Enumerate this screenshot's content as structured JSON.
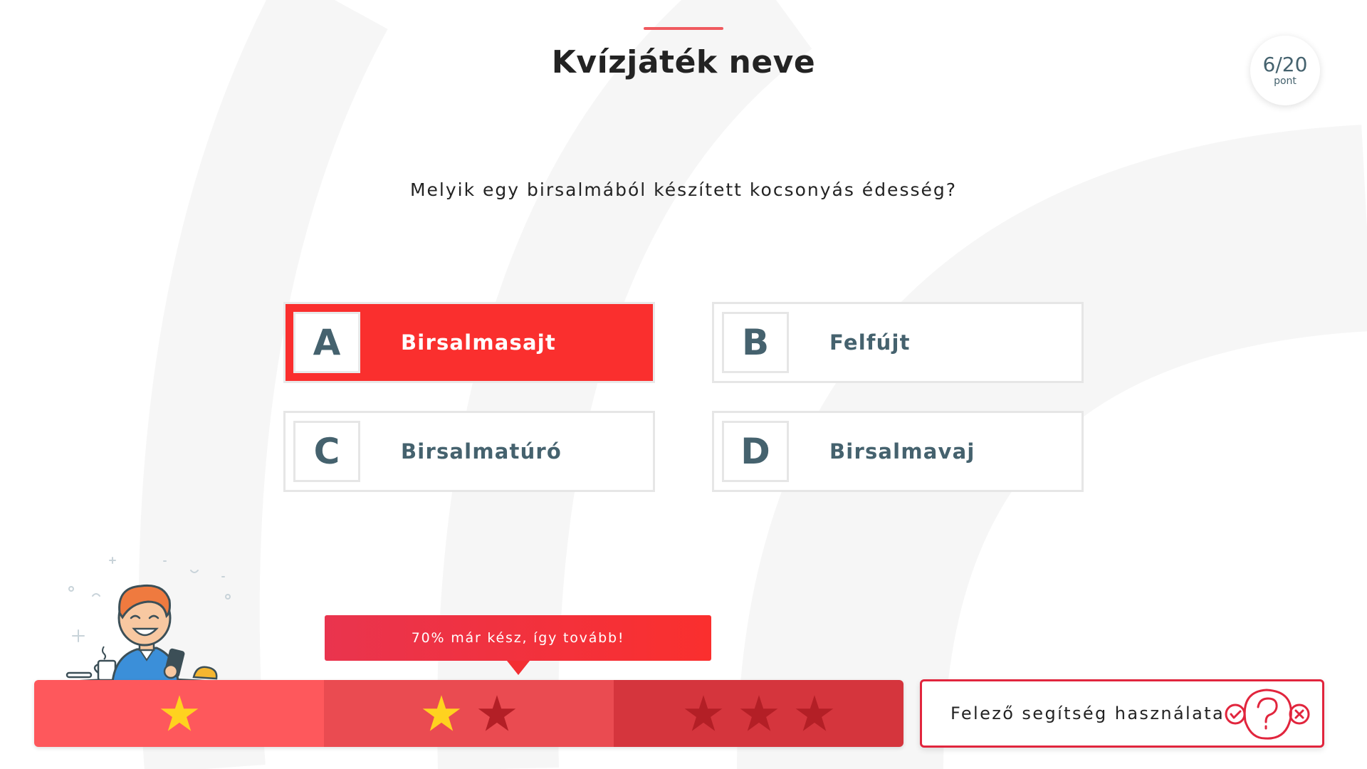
{
  "header": {
    "title": "Kvízjáték neve"
  },
  "score": {
    "value": "6/20",
    "unit": "pont"
  },
  "question": {
    "text": "Melyik egy birsalmából készített kocsonyás édesség?"
  },
  "answers": [
    {
      "letter": "A",
      "text": "Birsalmasajt",
      "selected": true
    },
    {
      "letter": "B",
      "text": "Felfújt",
      "selected": false
    },
    {
      "letter": "C",
      "text": "Birsalmatúró",
      "selected": false
    },
    {
      "letter": "D",
      "text": "Birsalmavaj",
      "selected": false
    }
  ],
  "progress": {
    "message": "70% már kész, így tovább!",
    "percent": 70,
    "segments": [
      {
        "stars_total": 1,
        "stars_earned": 1
      },
      {
        "stars_total": 2,
        "stars_earned": 1
      },
      {
        "stars_total": 3,
        "stars_earned": 0
      }
    ]
  },
  "help": {
    "label": "Felező segítség használata",
    "icon": "half-help-icon"
  },
  "colors": {
    "accent_red": "#fa2f2e",
    "text_teal": "#45626e",
    "star_gold": "#ffd21f",
    "star_empty": "#b31f26",
    "segment_1": "#fe585c",
    "segment_2": "#ea4b51",
    "segment_3": "#d5353d"
  }
}
